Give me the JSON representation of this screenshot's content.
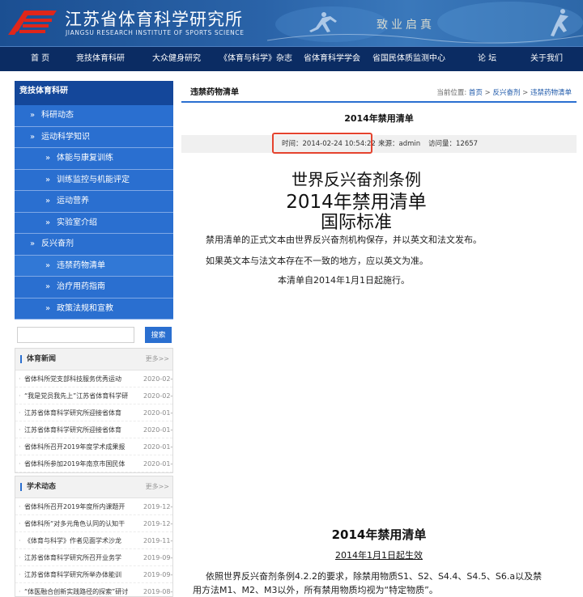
{
  "header": {
    "site_name_cn": "江苏省体育科学研究所",
    "site_name_en": "JIANGSU RESEARCH INSTITUTE OF SPORTS SCIENCE",
    "motto": "致业启真",
    "colors": {
      "brand_red": "#e0261a",
      "nav_bg": "#0b2c63",
      "header_blue": "#2a63a8"
    }
  },
  "nav": {
    "items": [
      {
        "label": "首 页"
      },
      {
        "label": "竞技体育科研"
      },
      {
        "label": "大众健身研究"
      },
      {
        "label": "《体育与科学》杂志"
      },
      {
        "label": "省体育科学学会"
      },
      {
        "label": "省国民体质监测中心"
      },
      {
        "label": "论 坛"
      },
      {
        "label": "关于我们"
      }
    ]
  },
  "sidebar": {
    "title": "竞技体育科研",
    "items": [
      {
        "label": "科研动态",
        "level": 1
      },
      {
        "label": "运动科学知识",
        "level": 1
      },
      {
        "label": "体能与康复训练",
        "level": 2
      },
      {
        "label": "训练监控与机能评定",
        "level": 2
      },
      {
        "label": "运动营养",
        "level": 2
      },
      {
        "label": "实验室介绍",
        "level": 2
      },
      {
        "label": "反兴奋剂",
        "level": 1
      },
      {
        "label": "违禁药物清单",
        "level": 2
      },
      {
        "label": "治疗用药指南",
        "level": 2
      },
      {
        "label": "政策法规和宣教",
        "level": 2
      }
    ],
    "arrow": "»"
  },
  "search": {
    "placeholder": "",
    "button_label": "搜索"
  },
  "sports_news": {
    "title": "体育新闻",
    "more": "更多>>",
    "rows": [
      {
        "text": "省体科所党支部科技服务优秀运动",
        "date": "2020-02-"
      },
      {
        "text": "“我是党员我先上”江苏省体育科学研",
        "date": "2020-02-"
      },
      {
        "text": "江苏省体育科学研究所迎接省体育",
        "date": "2020-01-"
      },
      {
        "text": "江苏省体育科学研究所迎接省体育",
        "date": "2020-01-"
      },
      {
        "text": "省体科所召开2019年度学术成果报",
        "date": "2020-01-"
      },
      {
        "text": "省体科所参加2019年南京市国民体",
        "date": "2020-01-"
      }
    ]
  },
  "academic_news": {
    "title": "学术动态",
    "more": "更多>>",
    "rows": [
      {
        "text": "省体科所召开2019年度所内课题开",
        "date": "2019-12-"
      },
      {
        "text": "省体科所“对多元角色认同的认知干",
        "date": "2019-12-"
      },
      {
        "text": "《体育与科学》作者见面学术沙龙",
        "date": "2019-11-"
      },
      {
        "text": "江苏省体育科学研究所召开业务学",
        "date": "2019-09-"
      },
      {
        "text": "江苏省体育科学研究所举办体能训",
        "date": "2019-09-"
      },
      {
        "text": "“体医融合创新实践路径的探索”研讨",
        "date": "2019-08-"
      }
    ]
  },
  "main": {
    "section_title": "违禁药物清单",
    "breadcrumb": {
      "prefix": "当前位置:",
      "home": "首页",
      "sep": ">",
      "parent": "反兴奋剂",
      "current": "违禁药物清单"
    },
    "article_title": "2014年禁用清单",
    "meta": {
      "time": "时间：2014-02-24 10:54:22",
      "source": "来源：admin",
      "views": "访问量：12657"
    },
    "heading_1": "世界反兴奋剂条例",
    "heading_2": "2014年禁用清单",
    "heading_3": "国际标准",
    "para_1": "禁用清单的正式文本由世界反兴奋剂机构保存，并以英文和法文发布。",
    "para_2": "如果英文本与法文本存在不一致的地方，应以英文为准。",
    "para_3": "本清单自2014年1月1日起施行。",
    "section_heading": "2014年禁用清单",
    "effective": "2014年1月1日起生效",
    "body_1": "依照世界反兴奋剂条例4.2.2的要求，除禁用物质S1、S2、S4.4、S4.5、S6.a以及禁",
    "body_2": "用方法M1、M2、M3以外，所有禁用物质均视为“特定物质”。"
  }
}
